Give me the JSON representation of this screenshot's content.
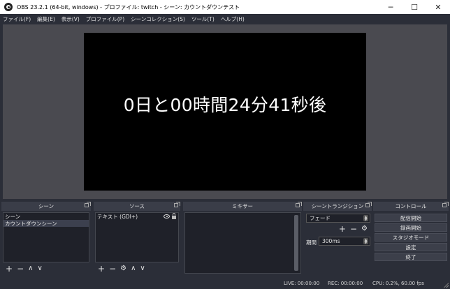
{
  "window": {
    "title": "OBS 23.2.1 (64-bit, windows) - プロファイル: twitch - シーン: カウントダウンテスト",
    "controls": {
      "minimize": "─",
      "maximize": "☐",
      "close": "✕"
    }
  },
  "menu": [
    "ファイル(F)",
    "編集(E)",
    "表示(V)",
    "プロファイル(P)",
    "シーンコレクション(S)",
    "ツール(T)",
    "ヘルプ(H)"
  ],
  "preview": {
    "text": "0日と00時間24分41秒後"
  },
  "scenes": {
    "title": "シーン",
    "items": [
      "シーン",
      "カウントダウンシーン"
    ],
    "selected_index": 1
  },
  "sources": {
    "title": "ソース",
    "items": [
      {
        "label": "テキスト (GDI+)",
        "visible": true,
        "locked": true
      }
    ]
  },
  "mixer": {
    "title": "ミキサー"
  },
  "transitions": {
    "title": "シーントランジション",
    "selected": "フェード",
    "duration_label": "期間",
    "duration_value": "300ms"
  },
  "controls": {
    "title": "コントロール",
    "buttons": [
      "配信開始",
      "録画開始",
      "スタジオモード",
      "設定",
      "終了"
    ]
  },
  "toolbar_glyphs": {
    "add": "+",
    "remove": "−",
    "up": "∧",
    "down": "∨",
    "gear": "⚙"
  },
  "status": {
    "live": "LIVE: 00:00:00",
    "rec": "REC: 00:00:00",
    "cpu": "CPU: 0.2%, 60.00 fps"
  },
  "colors": {
    "background": "#2b2e38",
    "panel": "#1f2129",
    "canvas": "#000000",
    "preview_bg": "#4a4a50"
  }
}
